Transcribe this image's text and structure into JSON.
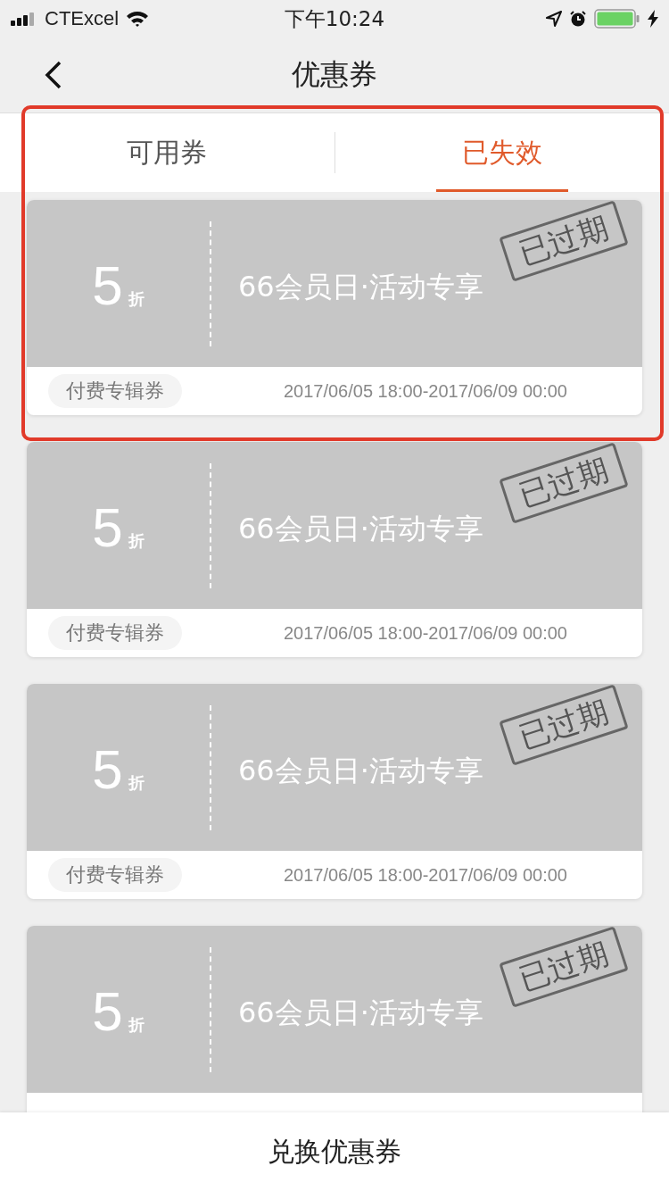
{
  "status_bar": {
    "carrier": "CTExcel",
    "time": "下午10:24"
  },
  "nav": {
    "title": "优惠券"
  },
  "tabs": [
    {
      "label": "可用券",
      "selected": false
    },
    {
      "label": "已失效",
      "selected": true
    }
  ],
  "highlight": {
    "kind": "box"
  },
  "coupons": [
    {
      "amount": "5",
      "unit": "折",
      "title": "66会员日·活动专享",
      "stamp": "已过期",
      "expired": true,
      "tag": "付费专辑券",
      "period": "2017/06/05 18:00-2017/06/09 00:00"
    },
    {
      "amount": "5",
      "unit": "折",
      "title": "66会员日·活动专享",
      "stamp": "已过期",
      "expired": true,
      "tag": "付费专辑券",
      "period": "2017/06/05 18:00-2017/06/09 00:00"
    },
    {
      "amount": "5",
      "unit": "折",
      "title": "66会员日·活动专享",
      "stamp": "已过期",
      "expired": true,
      "tag": "付费专辑券",
      "period": "2017/06/05 18:00-2017/06/09 00:00"
    },
    {
      "amount": "5",
      "unit": "折",
      "title": "66会员日·活动专享",
      "stamp": "已过期",
      "expired": true
    }
  ],
  "bottom_button": {
    "label": "兑换优惠券"
  }
}
